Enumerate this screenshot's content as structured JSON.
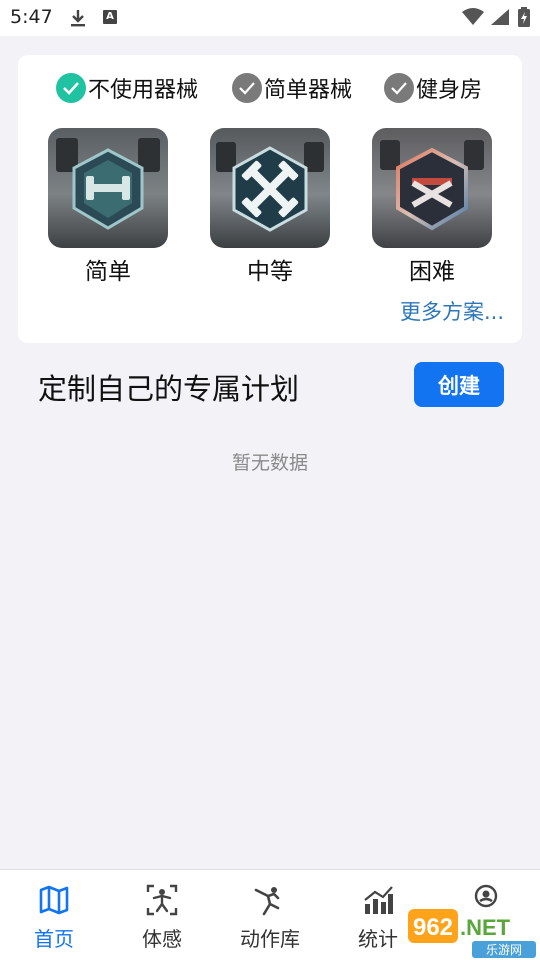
{
  "status": {
    "time": "5:47",
    "a_badge": "A"
  },
  "filters": [
    {
      "label": "不使用器械",
      "checked": true
    },
    {
      "label": "简单器械",
      "checked": false
    },
    {
      "label": "健身房",
      "checked": false
    }
  ],
  "levels": [
    {
      "label": "简单"
    },
    {
      "label": "中等"
    },
    {
      "label": "困难"
    }
  ],
  "more_link": "更多方案...",
  "plan": {
    "title": "定制自己的专属计划",
    "create_label": "创建",
    "empty": "暂无数据"
  },
  "tabs": [
    {
      "label": "首页",
      "icon": "map-icon",
      "active": true
    },
    {
      "label": "体感",
      "icon": "body-scan-icon",
      "active": false
    },
    {
      "label": "动作库",
      "icon": "exercise-pose-icon",
      "active": false
    },
    {
      "label": "统计",
      "icon": "bar-chart-icon",
      "active": false
    },
    {
      "label": "",
      "icon": "profile-icon",
      "active": false
    }
  ],
  "watermark": {
    "brand": "962.NET",
    "sub": "乐游网"
  },
  "colors": {
    "accent": "#1274f0",
    "check_on": "#1fc3a2",
    "check_off": "#7a7a7a",
    "link": "#2d77b8"
  }
}
